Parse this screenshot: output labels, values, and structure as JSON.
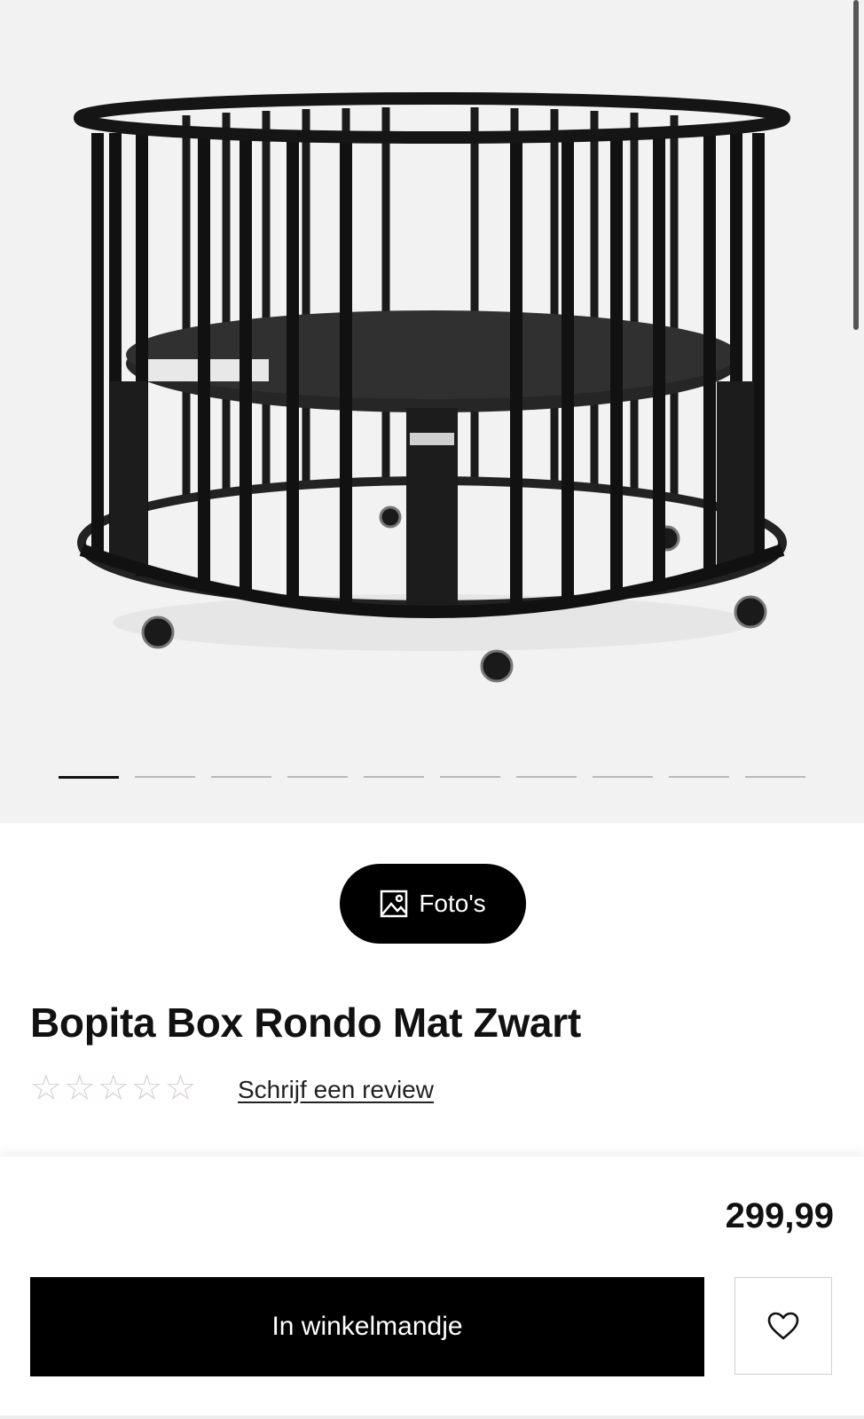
{
  "gallery": {
    "image_icon": "product-photo-playpen",
    "slide_count": 10,
    "active_slide": 1
  },
  "photos_button": {
    "label": "Foto's",
    "icon": "image-icon"
  },
  "product": {
    "title": "Bopita Box Rondo Mat Zwart",
    "rating": {
      "value": 0,
      "max": 5
    },
    "review_link": "Schrijf een review"
  },
  "purchase": {
    "price": "299,99",
    "cart_button": "In winkelmandje",
    "wishlist_icon": "heart-icon"
  },
  "colors": {
    "gallery_bg": "#f2f2f2",
    "primary": "#000000",
    "star_empty": "#d9cdcd"
  }
}
